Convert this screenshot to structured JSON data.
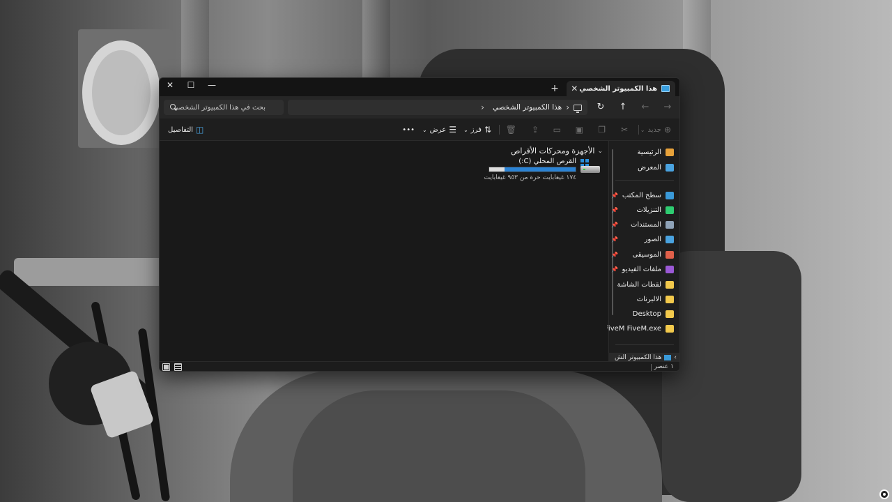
{
  "window": {
    "tab_title": "هذا الكمبيوتر الشخصي",
    "tab_close_glyph": "✕",
    "new_tab_glyph": "+",
    "controls": {
      "close": "✕",
      "maximize": "☐",
      "minimize": "—"
    }
  },
  "nav": {
    "back": "←",
    "forward": "→",
    "up": "↑",
    "refresh": "↻",
    "breadcrumb": "هذا الكمبيوتر الشخصي",
    "search_placeholder": "بحث في هذا الكمبيوتر الشخصي"
  },
  "toolbar": {
    "new_label": "جديد",
    "sort_label": "فرز",
    "view_label": "عرض",
    "more_glyph": "•••",
    "details_label": "التفاصيل"
  },
  "sidebar": {
    "home": "الرئيسية",
    "gallery": "المعرض",
    "pinned": [
      {
        "label": "سطح المكتب",
        "color": "#3a9ad9"
      },
      {
        "label": "التنزيلات",
        "color": "#2ecc71"
      },
      {
        "label": "المستندات",
        "color": "#8fa3b8"
      },
      {
        "label": "الصور",
        "color": "#4aa3e0"
      },
      {
        "label": "الموسيقى",
        "color": "#e0604a"
      },
      {
        "label": "ملفات الفيديو",
        "color": "#9b59d6"
      }
    ],
    "folders": [
      {
        "label": "لقطات الشاشة",
        "color": "#f2c94c"
      },
      {
        "label": "الالبرنات",
        "color": "#f2c94c"
      },
      {
        "label": "Desktop",
        "color": "#f2c94c"
      },
      {
        "label": "FiveM FiveM.exe",
        "color": "#f2c94c"
      }
    ],
    "this_pc": "هذا الكمبيوتر الش"
  },
  "content": {
    "group_title": "الأجهزة ومحركات الأقراص",
    "drive": {
      "label": "القرص المحلي (C:)",
      "free_text": "١٧٤ غيغابايت حرة من ٩٥٣ غيغابايت",
      "used_fraction": 0.82
    }
  },
  "status": {
    "item_count": "١ عنصر"
  },
  "colors": {
    "accent": "#2b83d4",
    "window_bg": "#191919",
    "folder": "#f2c94c"
  }
}
